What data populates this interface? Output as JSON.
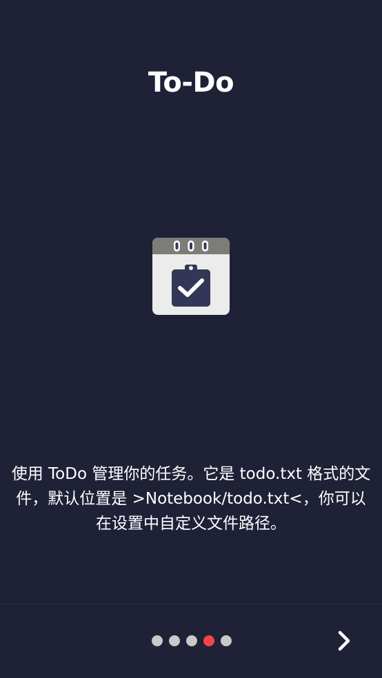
{
  "intro": {
    "title": "To-Do",
    "description": "使用 ToDo 管理你的任务。它是 todo.txt 格式的文件，默认位置是 >Notebook/todo.txt<，你可以在设置中自定义文件路径。",
    "icon": "calendar-clipboard-check-icon"
  },
  "pager": {
    "total": 5,
    "active_index": 3,
    "active_color": "#ef4747",
    "inactive_color": "#c9c9c9",
    "next_icon": "chevron-right-icon"
  },
  "colors": {
    "background": "#1f2137",
    "icon_header": "#7d7d78",
    "icon_body": "#ececec",
    "clipboard": "#343657"
  }
}
